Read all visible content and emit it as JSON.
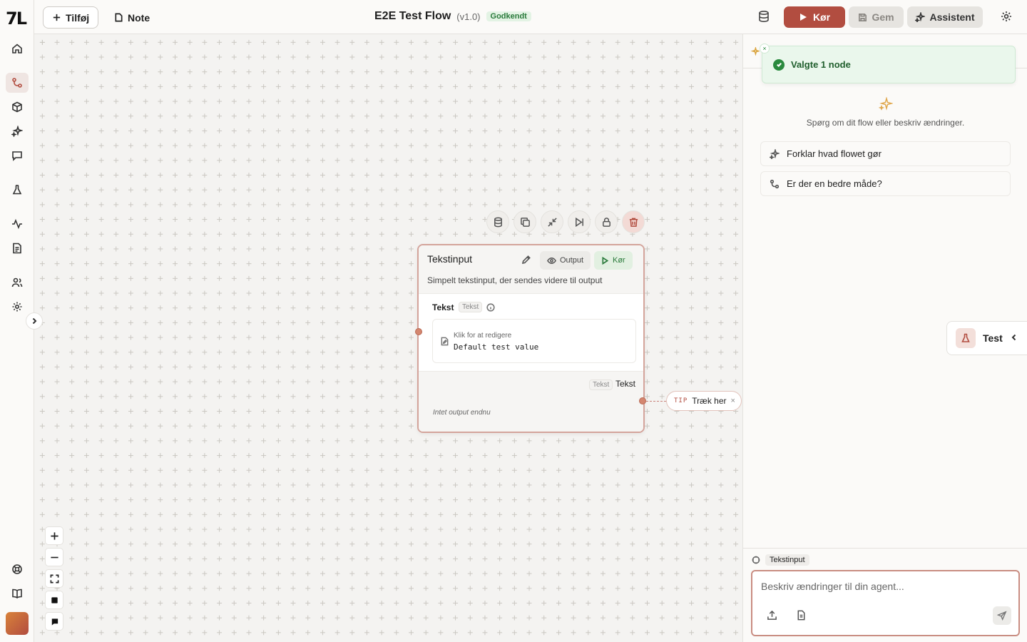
{
  "app": {
    "logo_text": "7L",
    "colors": {
      "accent": "#b24d40",
      "success": "#2a7a3b",
      "canvas_bg": "#f4f3f1"
    }
  },
  "toolbar": {
    "add_label": "Tilføj",
    "note_label": "Note",
    "title": "E2E Test Flow",
    "version": "(v1.0)",
    "status_badge": "Godkendt",
    "run_label": "Kør",
    "save_label": "Gem",
    "assistant_label": "Assistent"
  },
  "sidebar": {
    "items": [
      {
        "name": "home-icon"
      },
      {
        "name": "flows-icon",
        "active": true
      },
      {
        "name": "box-icon"
      },
      {
        "name": "sparkles-icon"
      },
      {
        "name": "chat-icon"
      },
      {
        "name": "flask-icon"
      },
      {
        "name": "activity-icon"
      },
      {
        "name": "document-icon"
      },
      {
        "name": "users-icon"
      },
      {
        "name": "gear-icon"
      },
      {
        "name": "help-icon"
      },
      {
        "name": "book-icon"
      }
    ]
  },
  "node": {
    "title": "Tekstinput",
    "description": "Simpelt tekstinput, der sendes videre til output",
    "output_button": "Output",
    "run_button": "Kør",
    "field_label": "Tekst",
    "field_type": "Tekst",
    "field_hint": "Klik for at redigere",
    "field_value": "Default test value",
    "output_type": "Tekst",
    "output_label": "Tekst",
    "output_empty": "Intet output endnu"
  },
  "tip": {
    "tag": "TIP",
    "text": "Træk her",
    "close": "×"
  },
  "panel": {
    "toast": "Valgte 1 node",
    "toast_close": "×",
    "empty_text": "Spørg om dit flow eller beskriv ændringer.",
    "suggestions": [
      {
        "label": "Forklar hvad flowet gør",
        "icon": "sparkles-icon"
      },
      {
        "label": "Er der en bedre måde?",
        "icon": "flows-icon"
      }
    ],
    "test_tab": "Test",
    "context_chip": "Tekstinput",
    "compose_placeholder": "Beskriv ændringer til din agent..."
  }
}
